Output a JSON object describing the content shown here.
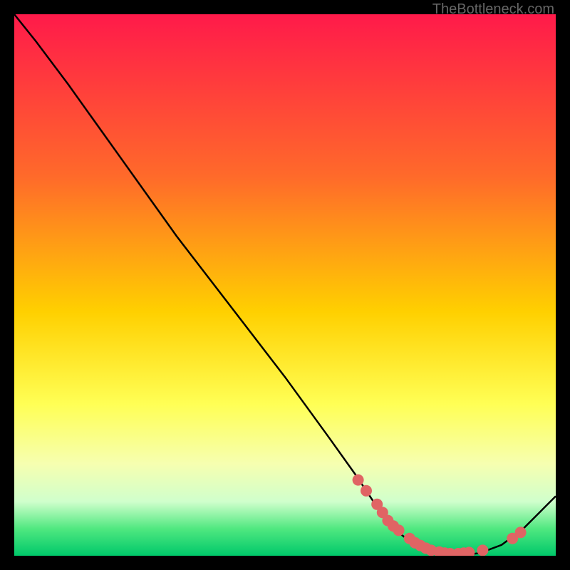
{
  "watermark": "TheBottleneck.com",
  "chart_data": {
    "type": "line",
    "title": "",
    "xlabel": "",
    "ylabel": "",
    "xlim": [
      0,
      100
    ],
    "ylim": [
      0,
      100
    ],
    "gradient_stops": [
      {
        "offset": 0,
        "color": "#ff1a4a"
      },
      {
        "offset": 30,
        "color": "#ff6a2a"
      },
      {
        "offset": 55,
        "color": "#ffd000"
      },
      {
        "offset": 72,
        "color": "#ffff55"
      },
      {
        "offset": 83,
        "color": "#f6ffb0"
      },
      {
        "offset": 90,
        "color": "#d0ffcc"
      },
      {
        "offset": 95,
        "color": "#50e880"
      },
      {
        "offset": 100,
        "color": "#00c86a"
      }
    ],
    "curve": [
      {
        "x": 0,
        "y": 100
      },
      {
        "x": 4,
        "y": 95
      },
      {
        "x": 10,
        "y": 87
      },
      {
        "x": 20,
        "y": 73
      },
      {
        "x": 30,
        "y": 59
      },
      {
        "x": 40,
        "y": 46
      },
      {
        "x": 50,
        "y": 33
      },
      {
        "x": 58,
        "y": 22
      },
      {
        "x": 63,
        "y": 15
      },
      {
        "x": 67,
        "y": 9
      },
      {
        "x": 70,
        "y": 5
      },
      {
        "x": 74,
        "y": 2
      },
      {
        "x": 78,
        "y": 0.5
      },
      {
        "x": 82,
        "y": 0
      },
      {
        "x": 86,
        "y": 0.5
      },
      {
        "x": 90,
        "y": 2
      },
      {
        "x": 94,
        "y": 5
      },
      {
        "x": 97,
        "y": 8
      },
      {
        "x": 100,
        "y": 11
      }
    ],
    "markers": [
      {
        "x": 63.5,
        "y": 14
      },
      {
        "x": 65.0,
        "y": 12
      },
      {
        "x": 67.0,
        "y": 9.5
      },
      {
        "x": 68.0,
        "y": 8
      },
      {
        "x": 69.0,
        "y": 6.5
      },
      {
        "x": 70.0,
        "y": 5.5
      },
      {
        "x": 71.0,
        "y": 4.7
      },
      {
        "x": 73.0,
        "y": 3.2
      },
      {
        "x": 74.0,
        "y": 2.4
      },
      {
        "x": 75.0,
        "y": 1.9
      },
      {
        "x": 76.0,
        "y": 1.4
      },
      {
        "x": 77.0,
        "y": 1.0
      },
      {
        "x": 78.5,
        "y": 0.7
      },
      {
        "x": 79.5,
        "y": 0.5
      },
      {
        "x": 80.5,
        "y": 0.4
      },
      {
        "x": 82.0,
        "y": 0.4
      },
      {
        "x": 83.0,
        "y": 0.5
      },
      {
        "x": 84.0,
        "y": 0.6
      },
      {
        "x": 86.5,
        "y": 1.0
      },
      {
        "x": 92.0,
        "y": 3.2
      },
      {
        "x": 93.5,
        "y": 4.3
      }
    ],
    "marker_color": "#e06464",
    "marker_radius": 8
  }
}
